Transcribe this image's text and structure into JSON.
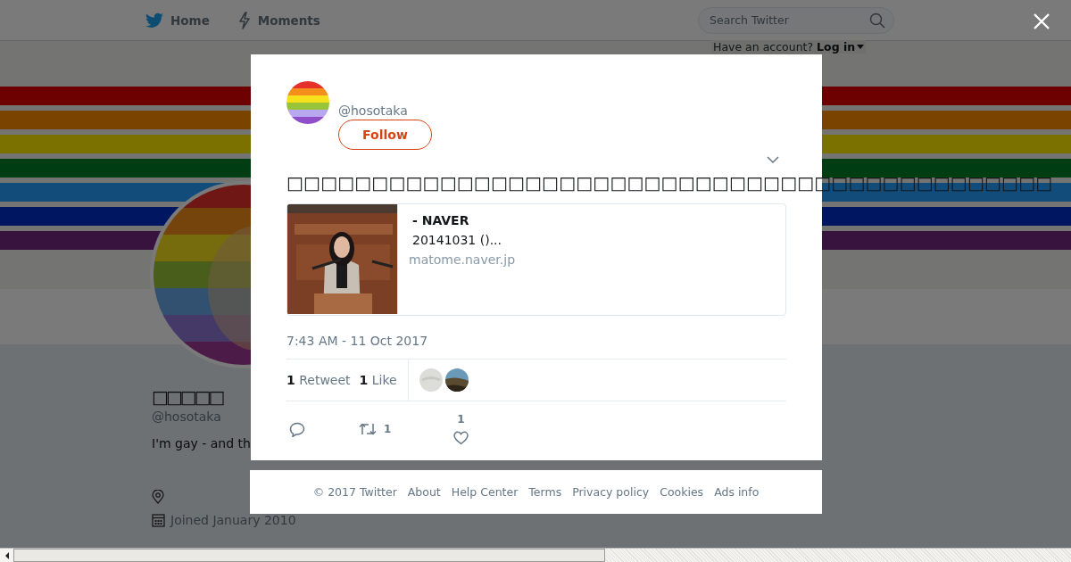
{
  "nav": {
    "items": [
      {
        "kind": "bird",
        "label": "Home"
      },
      {
        "kind": "bolt",
        "label": "Moments"
      }
    ],
    "search": {
      "placeholder": "Search Twitter"
    },
    "login_prompt": "Have an account?",
    "login_link": "Log in"
  },
  "profile": {
    "name": "□□□□□",
    "handle": "@hosotaka",
    "bio": "I'm gay - and th",
    "joined": "Joined January 2010"
  },
  "tweet": {
    "handle": "@hosotaka",
    "follow_button": "Follow",
    "text": "□□□□□□□□□□□□□□□□□□□□□□□□□□□□□□□□□□□□□□□□□□□□□",
    "card": {
      "title": "- NAVER",
      "description": "20141031 ()...",
      "domain": "matome.naver.jp"
    },
    "timestamp": "7:43 AM - 11 Oct 2017",
    "stats": [
      {
        "count": "1",
        "label": "Retweet"
      },
      {
        "count": "1",
        "label": "Like"
      }
    ],
    "actions": [
      {
        "kind": "reply"
      },
      {
        "kind": "retweet",
        "count": "1"
      },
      {
        "kind": "like",
        "count": "1"
      }
    ]
  },
  "footer": {
    "copyright": "© 2017 Twitter",
    "links": [
      "About",
      "Help Center",
      "Terms",
      "Privacy policy",
      "Cookies",
      "Ads info"
    ]
  }
}
